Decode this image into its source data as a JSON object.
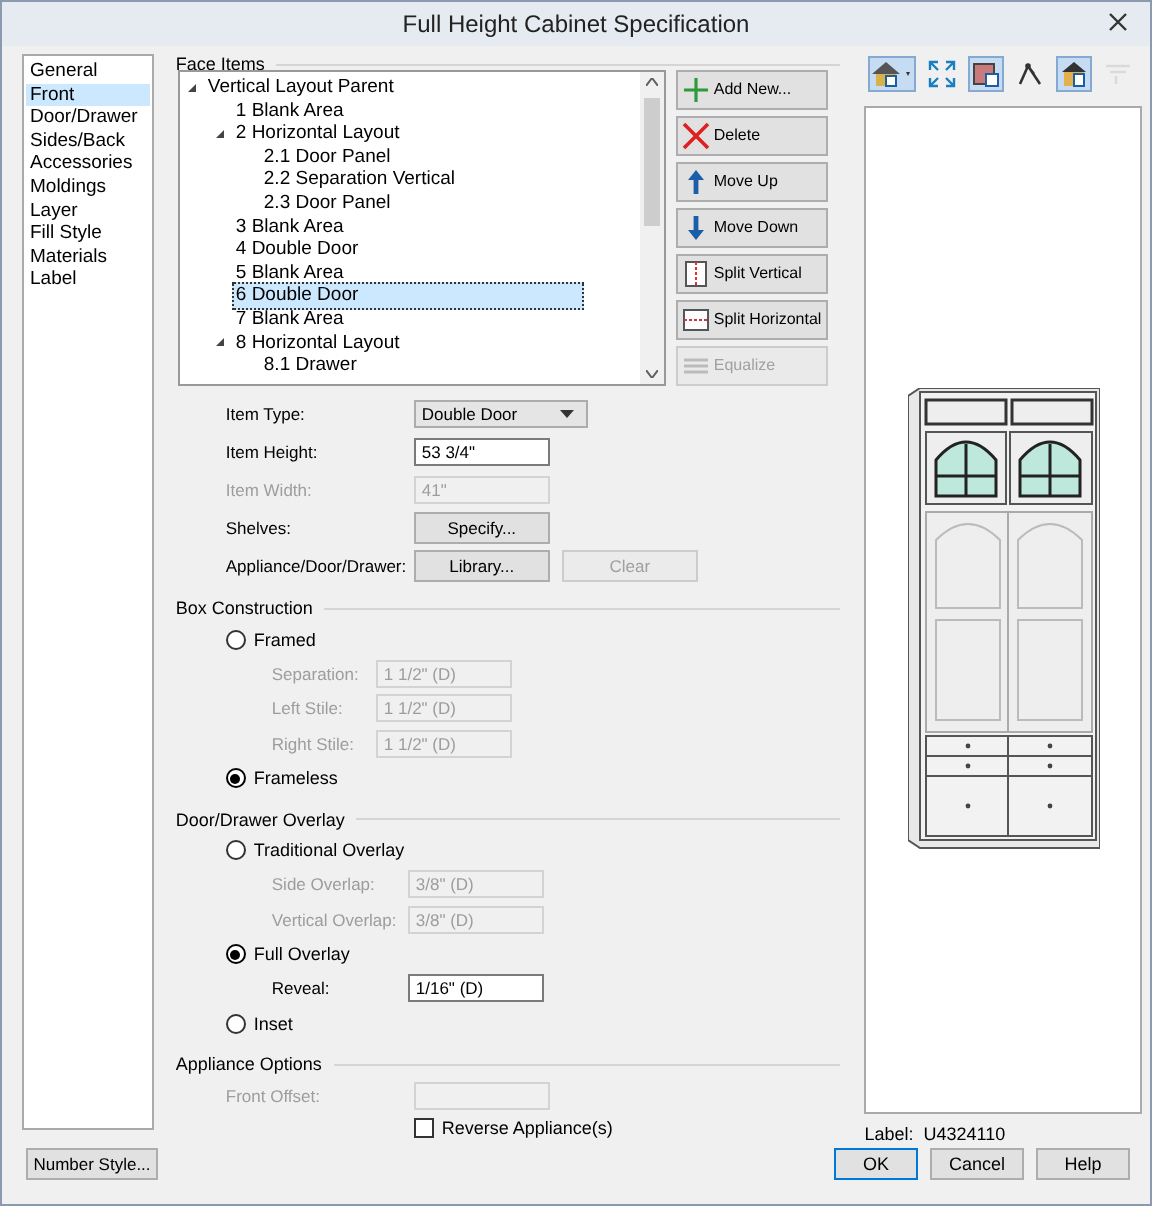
{
  "window": {
    "title": "Full Height Cabinet Specification"
  },
  "sidebar": {
    "items": [
      {
        "label": "General",
        "selected": false
      },
      {
        "label": "Front",
        "selected": true
      },
      {
        "label": "Door/Drawer",
        "selected": false
      },
      {
        "label": "Sides/Back",
        "selected": false
      },
      {
        "label": "Accessories",
        "selected": false
      },
      {
        "label": "Moldings",
        "selected": false
      },
      {
        "label": "Layer",
        "selected": false
      },
      {
        "label": "Fill Style",
        "selected": false
      },
      {
        "label": "Materials",
        "selected": false
      },
      {
        "label": "Label",
        "selected": false
      }
    ]
  },
  "face_items": {
    "title": "Face Items",
    "tree": [
      {
        "label": "Vertical Layout Parent",
        "expanded": true,
        "selected": false,
        "children": [
          {
            "label": "1 Blank Area",
            "selected": false
          },
          {
            "label": "2 Horizontal Layout",
            "expanded": true,
            "selected": false,
            "children": [
              {
                "label": "2.1 Door Panel",
                "selected": false
              },
              {
                "label": "2.2 Separation Vertical",
                "selected": false
              },
              {
                "label": "2.3 Door Panel",
                "selected": false
              }
            ]
          },
          {
            "label": "3 Blank Area",
            "selected": false
          },
          {
            "label": "4 Double Door",
            "selected": false
          },
          {
            "label": "5 Blank Area",
            "selected": false
          },
          {
            "label": "6 Double Door",
            "selected": true
          },
          {
            "label": "7 Blank Area",
            "selected": false
          },
          {
            "label": "8 Horizontal Layout",
            "expanded": true,
            "selected": false,
            "children": [
              {
                "label": "8.1 Drawer",
                "selected": false
              }
            ]
          }
        ]
      }
    ],
    "buttons": [
      {
        "kind": "add",
        "label": "Add New...",
        "disabled": false
      },
      {
        "kind": "delete",
        "label": "Delete",
        "disabled": false
      },
      {
        "kind": "up",
        "label": "Move Up",
        "disabled": false
      },
      {
        "kind": "down",
        "label": "Move Down",
        "disabled": false
      },
      {
        "kind": "split_vertical",
        "label": "Split Vertical",
        "disabled": false
      },
      {
        "kind": "split_horizontal",
        "label": "Split Horizontal",
        "disabled": false
      },
      {
        "kind": "equalize",
        "label": "Equalize",
        "disabled": true
      }
    ]
  },
  "item_fields": [
    {
      "kind": "dropdown",
      "label": "Item Type:",
      "value": "Double Door",
      "disabled": false
    },
    {
      "kind": "input",
      "label": "Item Height:",
      "value": "53 3/4\"",
      "disabled": false
    },
    {
      "kind": "input",
      "label": "Item Width:",
      "value": "41\"",
      "disabled": true
    },
    {
      "kind": "buttons",
      "label": "Shelves:",
      "disabled": false,
      "buttons": [
        {
          "label": "Specify...",
          "disabled": false
        }
      ]
    },
    {
      "kind": "buttons",
      "label": "Appliance/Door/Drawer:",
      "disabled": false,
      "buttons": [
        {
          "label": "Library...",
          "disabled": false
        },
        {
          "label": "Clear",
          "disabled": true
        }
      ]
    }
  ],
  "box_construction": {
    "title": "Box Construction",
    "options": [
      {
        "label": "Framed",
        "selected": false,
        "fields": [
          {
            "label": "Separation:",
            "value": "1 1/2\" (D)",
            "disabled": true
          },
          {
            "label": "Left Stile:",
            "value": "1 1/2\" (D)",
            "disabled": true
          },
          {
            "label": "Right Stile:",
            "value": "1 1/2\" (D)",
            "disabled": true
          }
        ]
      },
      {
        "label": "Frameless",
        "selected": true
      }
    ]
  },
  "door_drawer_overlay": {
    "title": "Door/Drawer Overlay",
    "options": [
      {
        "label": "Traditional Overlay",
        "selected": false,
        "fields": [
          {
            "label": "Side Overlap:",
            "value": "3/8\" (D)",
            "disabled": true
          },
          {
            "label": "Vertical Overlap:",
            "value": "3/8\" (D)",
            "disabled": true
          }
        ]
      },
      {
        "label": "Full Overlay",
        "selected": true,
        "fields": [
          {
            "label": "Reveal:",
            "value": "1/16\" (D)",
            "disabled": false
          }
        ]
      },
      {
        "label": "Inset",
        "selected": false
      }
    ]
  },
  "appliance_options": {
    "title": "Appliance Options",
    "fields": [
      {
        "label": "Front Offset:",
        "disabled": true
      }
    ],
    "checkbox": {
      "label": "Reverse Appliance(s)",
      "checked": false
    }
  },
  "preview": {
    "toolbar": [
      {
        "kind": "camera",
        "selected": true,
        "disabled": false
      },
      {
        "kind": "fit",
        "selected": false,
        "disabled": false
      },
      {
        "kind": "color",
        "selected": true,
        "disabled": false
      },
      {
        "kind": "edges",
        "selected": false,
        "disabled": false
      },
      {
        "kind": "shading",
        "selected": true,
        "disabled": false
      },
      {
        "kind": "dimension",
        "selected": false,
        "disabled": true
      }
    ],
    "label": "Label:  U4324110"
  },
  "footer": {
    "number_style": "Number Style...",
    "buttons": [
      "OK",
      "Cancel",
      "Help"
    ]
  }
}
